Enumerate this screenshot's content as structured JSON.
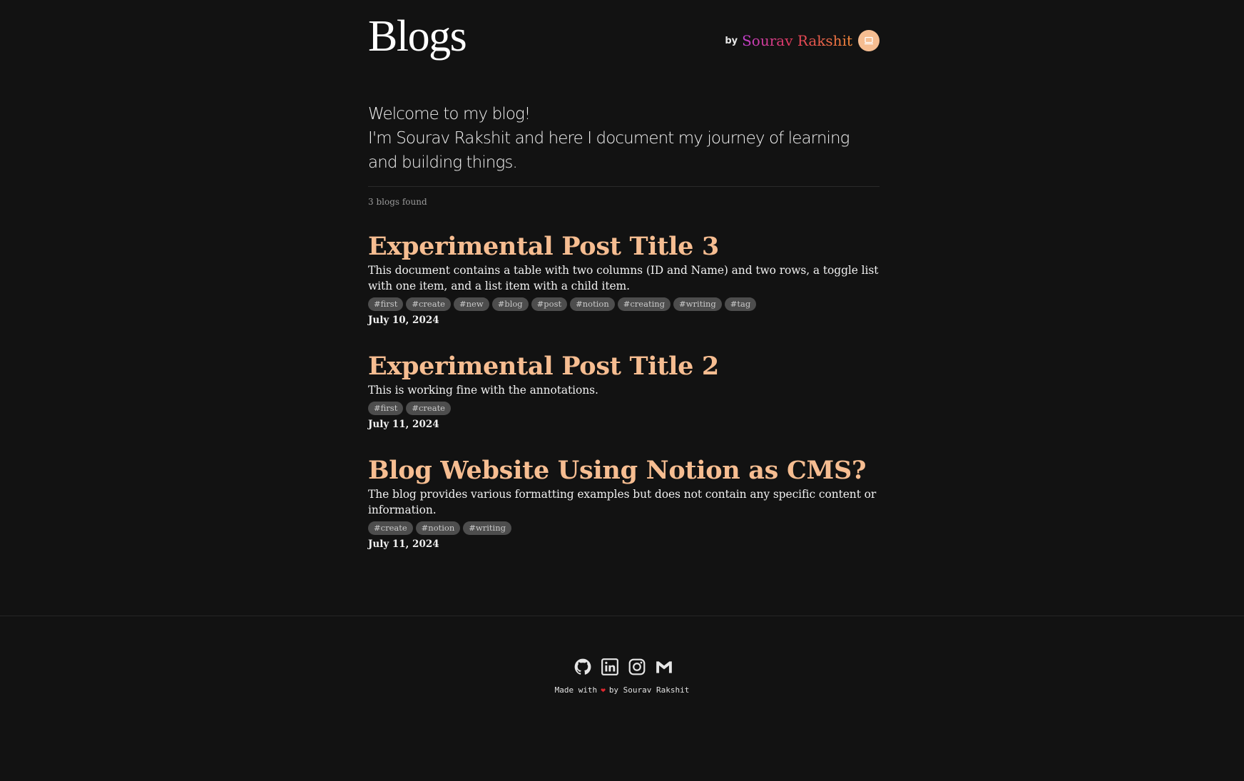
{
  "header": {
    "title": "Blogs",
    "by_word": "by",
    "author_name": "Sourav Rakshit"
  },
  "intro": {
    "line1": "Welcome to my blog!",
    "line2": "I'm Sourav Rakshit and here I document my journey of learning and building things."
  },
  "count_text": "3 blogs found",
  "posts": [
    {
      "title": "Experimental Post Title 3",
      "description": "This document contains a table with two columns (ID and Name) and two rows, a toggle list with one item, and a list item with a child item.",
      "tags": [
        "#first",
        "#create",
        "#new",
        "#blog",
        "#post",
        "#notion",
        "#creating",
        "#writing",
        "#tag"
      ],
      "date": "July 10, 2024"
    },
    {
      "title": "Experimental Post Title 2",
      "description": "This is working fine with the annotations.",
      "tags": [
        "#first",
        "#create"
      ],
      "date": "July 11, 2024"
    },
    {
      "title": "Blog Website Using Notion as CMS?",
      "description": "The blog provides various formatting examples but does not contain any specific content or information.",
      "tags": [
        "#create",
        "#notion",
        "#writing"
      ],
      "date": "July 11, 2024"
    }
  ],
  "footer": {
    "made_with": "Made with",
    "by_text": "by Sourav Rakshit",
    "socials": [
      "github-icon",
      "linkedin-icon",
      "instagram-icon",
      "gmail-icon"
    ]
  },
  "colors": {
    "background": "#121212",
    "accent": "#f6bd91",
    "tag_bg": "#4d4d4d",
    "heart": "#e0282f"
  }
}
